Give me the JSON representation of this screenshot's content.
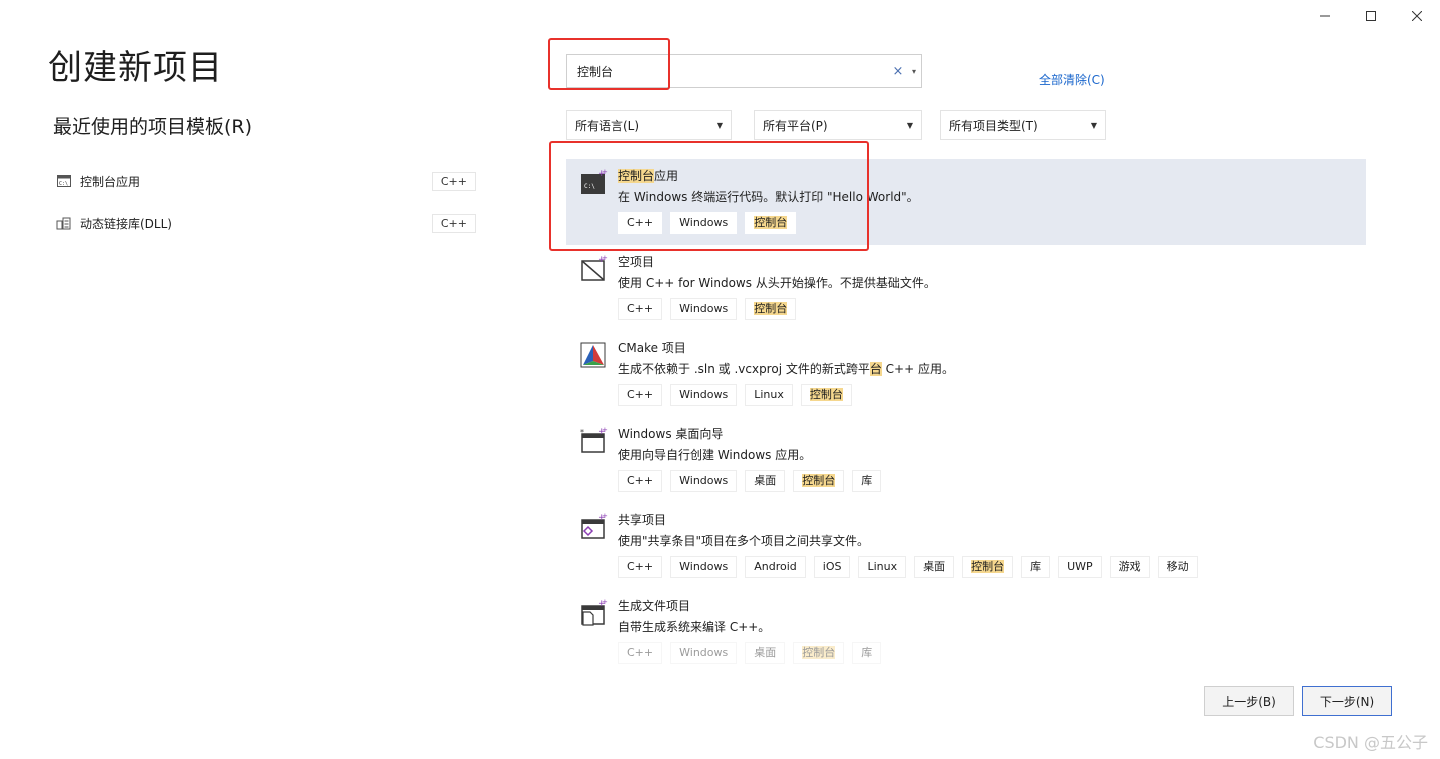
{
  "window": {
    "controls": [
      "minimize-icon",
      "maximize-icon",
      "close-icon"
    ]
  },
  "page_title": "创建新项目",
  "recent": {
    "title": "最近使用的项目模板(R)",
    "items": [
      {
        "label": "控制台应用",
        "lang": "C++",
        "icon": "console-app-icon"
      },
      {
        "label": "动态链接库(DLL)",
        "lang": "C++",
        "icon": "dll-icon"
      }
    ]
  },
  "search": {
    "value": "控制台",
    "clear_icon": "×",
    "caret": "▾"
  },
  "clear_all": "全部清除(C)",
  "filters": [
    {
      "label": "所有语言(L)"
    },
    {
      "label": "所有平台(P)"
    },
    {
      "label": "所有项目类型(T)"
    }
  ],
  "templates": [
    {
      "name_hl": "控制台",
      "name_rest": "应用",
      "desc": "在 Windows 终端运行代码。默认打印 \"Hello World\"。",
      "tags": [
        "C++",
        "Windows",
        "控制台"
      ],
      "icon": "console-app-icon",
      "selected": true
    },
    {
      "name_hl": "",
      "name_rest": "空项目",
      "desc": "使用 C++ for Windows 从头开始操作。不提供基础文件。",
      "tags": [
        "C++",
        "Windows",
        "控制台"
      ],
      "icon": "empty-project-icon"
    },
    {
      "name_hl": "",
      "name_rest": "CMake 项目",
      "desc_pre": "生成不依赖于 .sln 或 .vcxproj 文件的新式跨平",
      "desc_hl": "台",
      "desc_post": " C++ 应用。",
      "tags": [
        "C++",
        "Windows",
        "Linux",
        "控制台"
      ],
      "icon": "cmake-icon"
    },
    {
      "name_hl": "",
      "name_rest": "Windows 桌面向导",
      "desc": "使用向导自行创建 Windows 应用。",
      "tags": [
        "C++",
        "Windows",
        "桌面",
        "控制台",
        "库"
      ],
      "icon": "desktop-wizard-icon"
    },
    {
      "name_hl": "",
      "name_rest": "共享项目",
      "desc": "使用\"共享条目\"项目在多个项目之间共享文件。",
      "tags": [
        "C++",
        "Windows",
        "Android",
        "iOS",
        "Linux",
        "桌面",
        "控制台",
        "库",
        "UWP",
        "游戏",
        "移动"
      ],
      "icon": "shared-project-icon"
    },
    {
      "name_hl": "",
      "name_rest": "生成文件项目",
      "desc": "自带生成系统来编译 C++。",
      "tags": [
        "C++",
        "Windows",
        "桌面",
        "控制台",
        "库"
      ],
      "icon": "makefile-project-icon",
      "faded_tags": true
    }
  ],
  "highlight_word": "控制台",
  "buttons": {
    "back": "上一步(B)",
    "next": "下一步(N)"
  },
  "watermark": "CSDN @五公子"
}
